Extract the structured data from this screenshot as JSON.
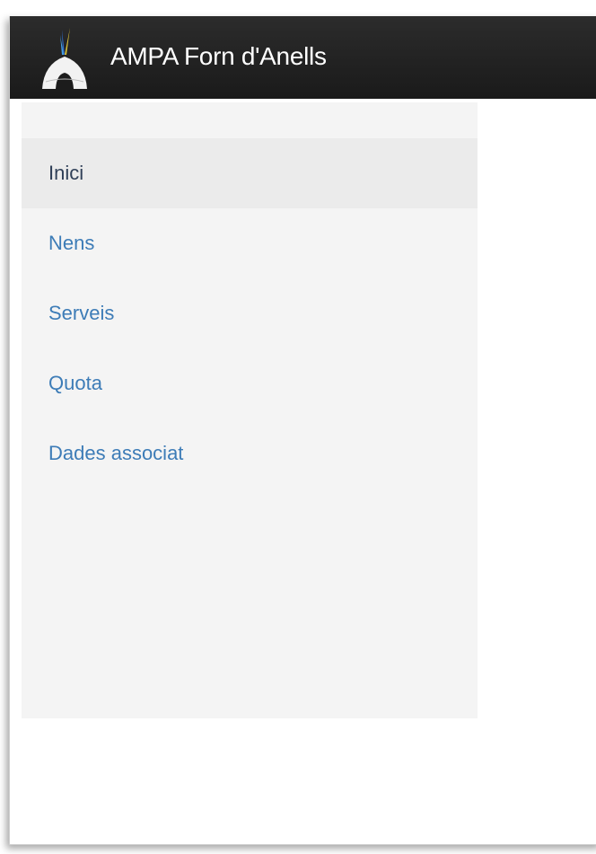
{
  "header": {
    "brand_text": "AMPA Forn d'Anells",
    "logo_icon": "igloo-feather-logo-icon"
  },
  "sidebar": {
    "items": [
      {
        "label": "Inici",
        "active": true
      },
      {
        "label": "Nens",
        "active": false
      },
      {
        "label": "Serveis",
        "active": false
      },
      {
        "label": "Quota",
        "active": false
      },
      {
        "label": "Dades associat",
        "active": false
      }
    ]
  },
  "colors": {
    "navbar": "#222222",
    "link": "#3d7cb7",
    "active_text": "#2f3f57",
    "sidebar_bg": "#f4f4f4",
    "active_bg": "#ebebeb"
  }
}
